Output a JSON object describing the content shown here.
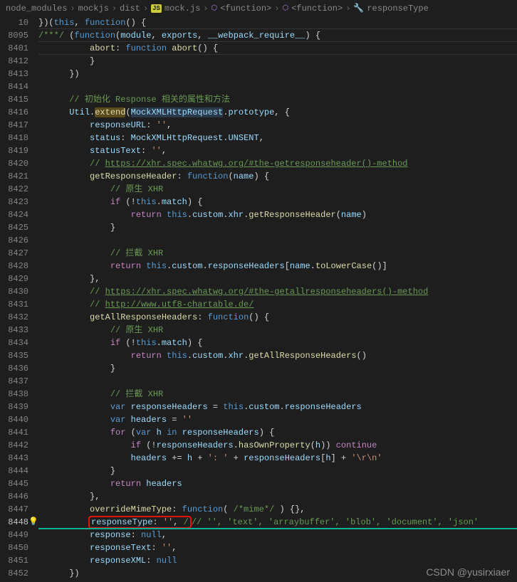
{
  "breadcrumbs": {
    "p1": "node_modules",
    "p2": "mockjs",
    "p3": "dist",
    "p4": "mock.js",
    "p5": "<function>",
    "p6": "<function>",
    "p7": "responseType"
  },
  "gutter": {
    "l1": "10",
    "l2": "8095",
    "l3": "8401",
    "l4": "8412",
    "l5": "8413",
    "l6": "8414",
    "l7": "8415",
    "l8": "8416",
    "l9": "8417",
    "l10": "8418",
    "l11": "8419",
    "l12": "8420",
    "l13": "8421",
    "l14": "8422",
    "l15": "8423",
    "l16": "8424",
    "l17": "8425",
    "l18": "8426",
    "l19": "8427",
    "l20": "8428",
    "l21": "8429",
    "l22": "8430",
    "l23": "8431",
    "l24": "8432",
    "l25": "8433",
    "l26": "8434",
    "l27": "8435",
    "l28": "8436",
    "l29": "8437",
    "l30": "8438",
    "l31": "8439",
    "l32": "8440",
    "l33": "8441",
    "l34": "8442",
    "l35": "8443",
    "l36": "8444",
    "l37": "8445",
    "l38": "8446",
    "l39": "8447",
    "l40": "8448",
    "l41": "8449",
    "l42": "8450",
    "l43": "8451",
    "l44": "8452"
  },
  "code": {
    "l1a": "})(",
    "l1b": "this",
    "l1c": ", ",
    "l1d": "function",
    "l1e": "() {",
    "l2a": "/***/",
    "l2b": " (",
    "l2c": "function",
    "l2d": "(",
    "l2e": "module",
    "l2f": ", ",
    "l2g": "exports",
    "l2h": ", ",
    "l2i": "__webpack_require__",
    "l2j": ") {",
    "l3a": "abort",
    "l3b": ": ",
    "l3c": "function",
    "l3d": " ",
    "l3e": "abort",
    "l3f": "() {",
    "l4a": "}",
    "l5a": "})",
    "l7a": "// 初始化 Response 相关的属性和方法",
    "l8a": "Util",
    "l8b": ".",
    "l8c": "extend",
    "l8d": "(",
    "l8e": "MockXMLHttpRequest",
    "l8f": ".",
    "l8g": "prototype",
    "l8h": ", {",
    "l9a": "responseURL",
    "l9b": ": ",
    "l9c": "''",
    "l9d": ",",
    "l10a": "status",
    "l10b": ": ",
    "l10c": "MockXMLHttpRequest",
    "l10d": ".",
    "l10e": "UNSENT",
    "l10f": ",",
    "l11a": "statusText",
    "l11b": ": ",
    "l11c": "''",
    "l11d": ",",
    "l12a": "// ",
    "l12b": "https://xhr.spec.whatwg.org/#the-getresponseheader()-method",
    "l13a": "getResponseHeader",
    "l13b": ": ",
    "l13c": "function",
    "l13d": "(",
    "l13e": "name",
    "l13f": ") {",
    "l14a": "// 原生 XHR",
    "l15a": "if",
    "l15b": " (!",
    "l15c": "this",
    "l15d": ".",
    "l15e": "match",
    "l15f": ") {",
    "l16a": "return",
    "l16b": " ",
    "l16c": "this",
    "l16d": ".",
    "l16e": "custom",
    "l16f": ".",
    "l16g": "xhr",
    "l16h": ".",
    "l16i": "getResponseHeader",
    "l16j": "(",
    "l16k": "name",
    "l16l": ")",
    "l17a": "}",
    "l19a": "// 拦截 XHR",
    "l20a": "return",
    "l20b": " ",
    "l20c": "this",
    "l20d": ".",
    "l20e": "custom",
    "l20f": ".",
    "l20g": "responseHeaders",
    "l20h": "[",
    "l20i": "name",
    "l20j": ".",
    "l20k": "toLowerCase",
    "l20l": "()]",
    "l21a": "},",
    "l22a": "// ",
    "l22b": "https://xhr.spec.whatwg.org/#the-getallresponseheaders()-method",
    "l23a": "// ",
    "l23b": "http://www.utf8-chartable.de/",
    "l24a": "getAllResponseHeaders",
    "l24b": ": ",
    "l24c": "function",
    "l24d": "() {",
    "l25a": "// 原生 XHR",
    "l26a": "if",
    "l26b": " (!",
    "l26c": "this",
    "l26d": ".",
    "l26e": "match",
    "l26f": ") {",
    "l27a": "return",
    "l27b": " ",
    "l27c": "this",
    "l27d": ".",
    "l27e": "custom",
    "l27f": ".",
    "l27g": "xhr",
    "l27h": ".",
    "l27i": "getAllResponseHeaders",
    "l27j": "()",
    "l28a": "}",
    "l30a": "// 拦截 XHR",
    "l31a": "var",
    "l31b": " ",
    "l31c": "responseHeaders",
    "l31d": " = ",
    "l31e": "this",
    "l31f": ".",
    "l31g": "custom",
    "l31h": ".",
    "l31i": "responseHeaders",
    "l32a": "var",
    "l32b": " ",
    "l32c": "headers",
    "l32d": " = ",
    "l32e": "''",
    "l33a": "for",
    "l33b": " (",
    "l33c": "var",
    "l33d": " ",
    "l33e": "h",
    "l33f": " ",
    "l33g": "in",
    "l33h": " ",
    "l33i": "responseHeaders",
    "l33j": ") {",
    "l34a": "if",
    "l34b": " (!",
    "l34c": "responseHeaders",
    "l34d": ".",
    "l34e": "hasOwnProperty",
    "l34f": "(",
    "l34g": "h",
    "l34h": ")) ",
    "l34i": "continue",
    "l35a": "headers",
    "l35b": " += ",
    "l35c": "h",
    "l35d": " + ",
    "l35e": "': '",
    "l35f": " + ",
    "l35g": "responseHeaders",
    "l35h": "[",
    "l35i": "h",
    "l35j": "] + ",
    "l35k": "'\\r\\n'",
    "l36a": "}",
    "l37a": "return",
    "l37b": " ",
    "l37c": "headers",
    "l38a": "},",
    "l39a": "overrideMimeType",
    "l39b": ": ",
    "l39c": "function",
    "l39d": "( ",
    "l39e": "/*mime*/",
    "l39f": " ) {},",
    "l40a": "responseType",
    "l40b": ": ",
    "l40c": "''",
    "l40d": ", ",
    "l40e": "// '', 'text', 'arraybuffer', 'blob', 'document', 'json'",
    "l41a": "response",
    "l41b": ": ",
    "l41c": "null",
    "l41d": ",",
    "l42a": "responseText",
    "l42b": ": ",
    "l42c": "''",
    "l42d": ",",
    "l43a": "responseXML",
    "l43b": ": ",
    "l43c": "null",
    "l44a": "})"
  },
  "watermark": "CSDN @yusirxiaer"
}
